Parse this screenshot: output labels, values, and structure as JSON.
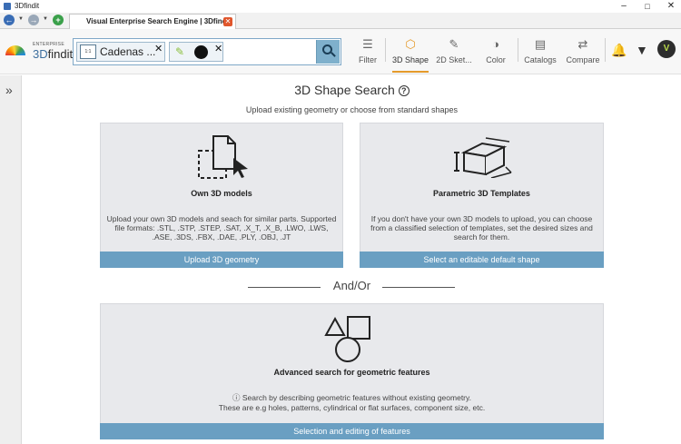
{
  "window": {
    "title": "3Dfindit"
  },
  "browser_tab": {
    "label": "Visual Enterprise Search Engine | 3Dfindit"
  },
  "logo": {
    "enterprise": "ENTERPRISE",
    "brand_prefix": "3D",
    "brand_suffix": "findit"
  },
  "search": {
    "chips": [
      {
        "label": "Cadenas ...",
        "thumb": "1:1"
      }
    ]
  },
  "toolbar": {
    "tools": [
      {
        "label": "Filter",
        "icon": "sliders-icon"
      },
      {
        "label": "3D Shape",
        "icon": "cube-icon",
        "active": true
      },
      {
        "label": "2D Sket...",
        "icon": "pencil-icon"
      },
      {
        "label": "Color",
        "icon": "palette-icon"
      },
      {
        "label": "Catalogs",
        "icon": "catalog-icon"
      },
      {
        "label": "Compare",
        "icon": "compare-icon"
      }
    ],
    "avatar_letter": "V",
    "accent": "#e59a2a"
  },
  "main": {
    "title": "3D Shape Search",
    "subtitle": "Upload existing geometry or choose from standard shapes",
    "cards": {
      "own_models": {
        "title": "Own 3D models",
        "description": "Upload your own 3D models and seach for similar parts. Supported file formats: .STL, .STP, .STEP, .SAT, .X_T, .X_B, .LWO, .LWS, .ASE, .3DS, .FBX, .DAE, .PLY, .OBJ, .JT",
        "button": "Upload 3D geometry"
      },
      "parametric": {
        "title": "Parametric 3D Templates",
        "description": "If you don't have your own 3D models to upload, you can choose from a classified selection of templates, set the desired sizes and search for them.",
        "button": "Select an editable default shape"
      },
      "features": {
        "title": "Advanced search for geometric features",
        "description_line1": "ⓘ Search by describing geometric features without existing geometry.",
        "description_line2": "These are e.g holes, patterns, cylindrical or flat surfaces, component size, etc.",
        "button": "Selection and editing of features"
      }
    },
    "separator": "And/Or",
    "button_color": "#6a9fc2"
  }
}
